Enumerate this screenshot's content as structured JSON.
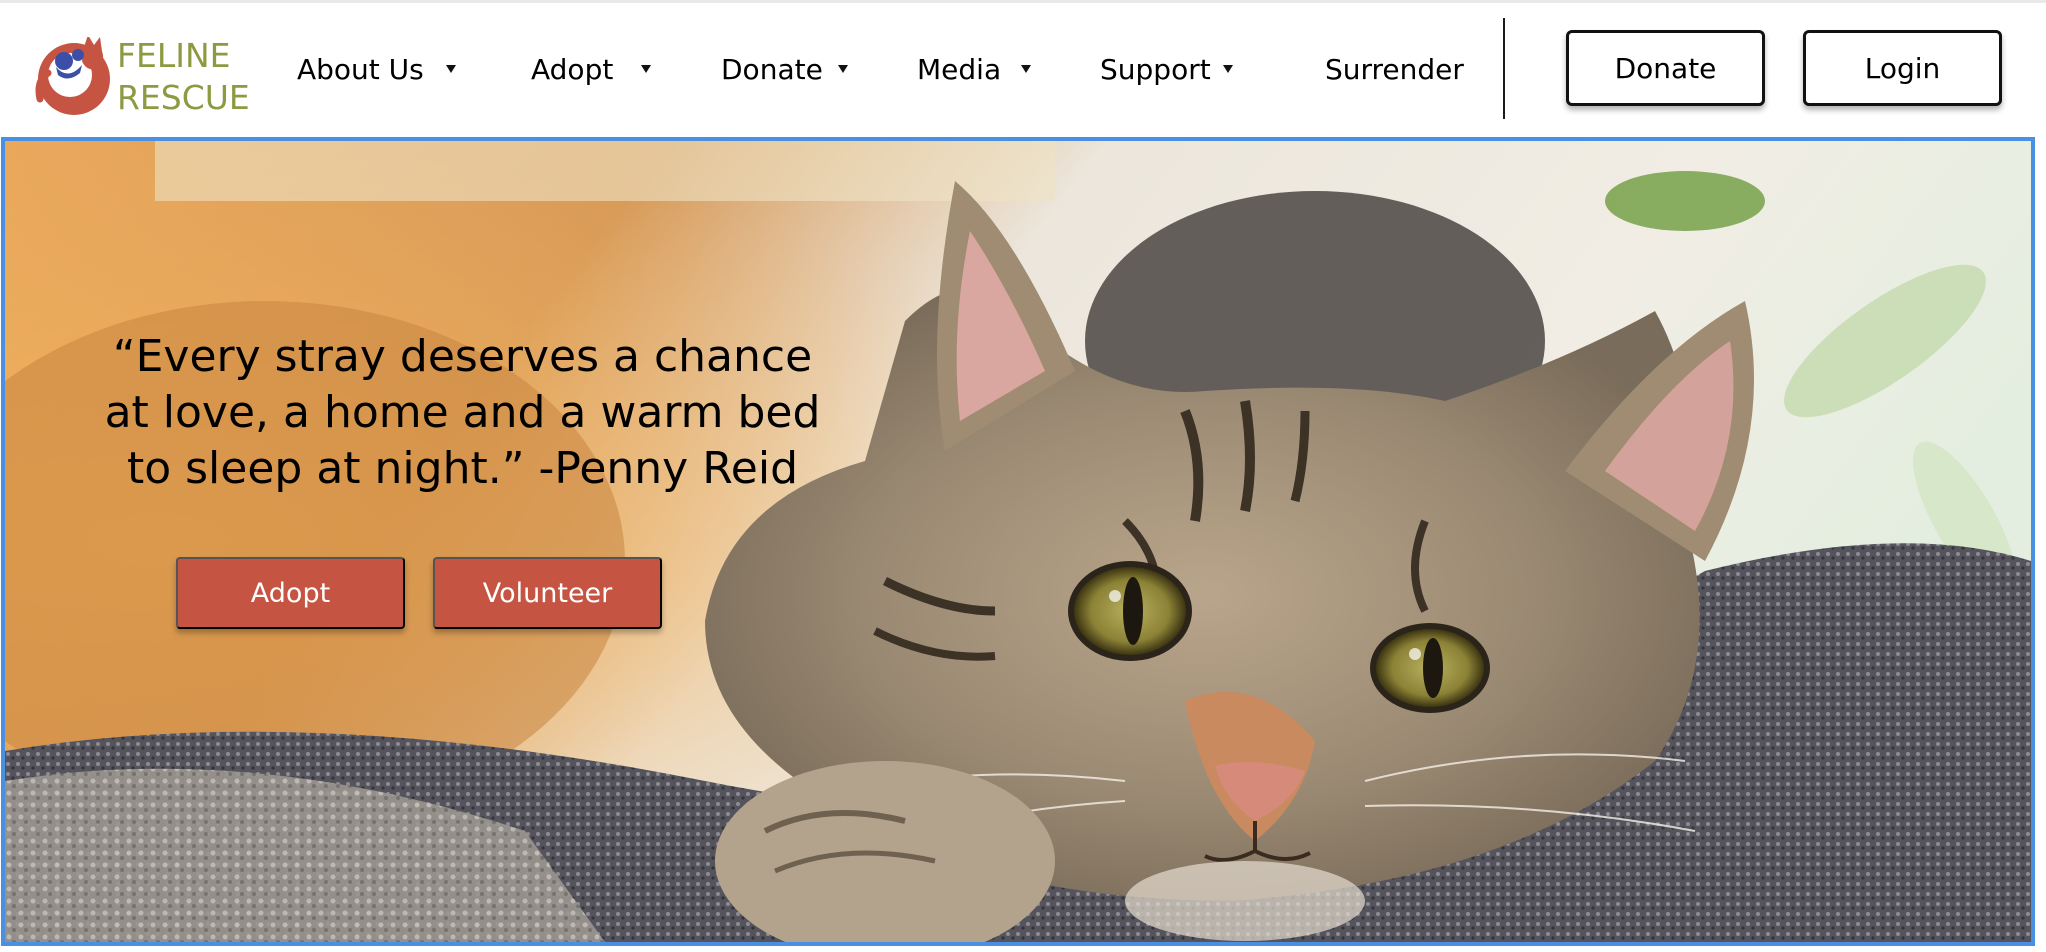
{
  "brand": {
    "name_line1": "FELINE",
    "name_line2": "RESCUE",
    "logo_icon": "cat-logo-icon",
    "text_color": "#8e9a42",
    "mark_color": "#c65443",
    "accent_blue": "#3b4fa8"
  },
  "nav": {
    "items": [
      {
        "label": "About Us",
        "icon": "caret-down-icon"
      },
      {
        "label": "Adopt",
        "icon": "caret-down-icon"
      },
      {
        "label": "Donate",
        "icon": "caret-down-icon"
      },
      {
        "label": "Media",
        "icon": "caret-down-icon"
      },
      {
        "label": "Support",
        "icon": "caret-down-icon"
      },
      {
        "label": "Surrender"
      }
    ],
    "donate_button": "Donate",
    "login_button": "Login"
  },
  "hero": {
    "quote": "“Every stray deserves a chance at love, a home and a warm bed to sleep at night.” -Penny Reid",
    "adopt_button": "Adopt",
    "volunteer_button": "Volunteer",
    "button_color": "#c65443",
    "border_color": "#4a90e2"
  }
}
